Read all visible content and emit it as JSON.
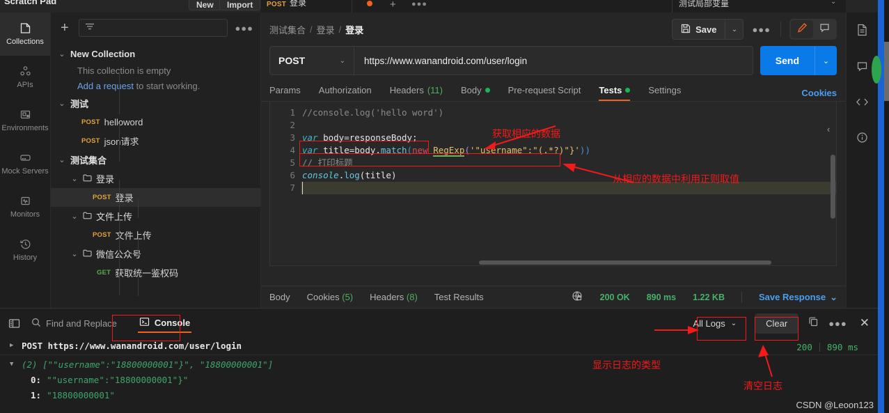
{
  "top": {
    "scratch_pad": "Scratch Pad",
    "new_label": "New",
    "import_label": "Import"
  },
  "rail": {
    "items": [
      {
        "label": "Collections",
        "icon": "collections-icon"
      },
      {
        "label": "APIs",
        "icon": "apis-icon"
      },
      {
        "label": "Environments",
        "icon": "environments-icon"
      },
      {
        "label": "Mock Servers",
        "icon": "mock-servers-icon"
      },
      {
        "label": "Monitors",
        "icon": "monitors-icon"
      },
      {
        "label": "History",
        "icon": "history-icon"
      }
    ]
  },
  "sidebar": {
    "filter_placeholder": "",
    "collections": [
      {
        "name": "New Collection",
        "empty_text": "This collection is empty",
        "empty_link": "Add a request",
        "empty_link_tail": " to start working."
      },
      {
        "name": "测试",
        "requests": [
          {
            "method": "POST",
            "name": "helloword"
          },
          {
            "method": "POST",
            "name": "json请求"
          }
        ]
      },
      {
        "name": "测试集合",
        "folders": [
          {
            "name": "登录",
            "requests": [
              {
                "method": "POST",
                "name": "登录",
                "selected": true
              }
            ]
          },
          {
            "name": "文件上传",
            "requests": [
              {
                "method": "POST",
                "name": "文件上传"
              }
            ]
          },
          {
            "name": "微信公众号",
            "requests": [
              {
                "method": "GET",
                "name": "获取统一鉴权码"
              }
            ]
          }
        ]
      }
    ]
  },
  "request_tab": {
    "method": "POST",
    "title": "登录",
    "environment": "测试局部变量"
  },
  "breadcrumb": {
    "items": [
      "测试集合",
      "登录",
      "登录"
    ],
    "separator": "/"
  },
  "actions": {
    "save_label": "Save",
    "save_icon": "floppy-disk-icon",
    "more_icon": "more-horizontal-icon",
    "edit_icon": "pencil-icon",
    "comment_icon": "comment-icon"
  },
  "url_bar": {
    "method": "POST",
    "url": "https://www.wanandroid.com/user/login",
    "send_label": "Send"
  },
  "param_tabs": {
    "items": [
      {
        "label": "Params"
      },
      {
        "label": "Authorization"
      },
      {
        "label": "Headers",
        "count": "(11)"
      },
      {
        "label": "Body",
        "dot": true
      },
      {
        "label": "Pre-request Script"
      },
      {
        "label": "Tests",
        "dot": true,
        "active": true
      },
      {
        "label": "Settings"
      }
    ],
    "cookies_label": "Cookies"
  },
  "editor": {
    "line_numbers": [
      "1",
      "2",
      "3",
      "4",
      "5",
      "6",
      "7"
    ],
    "lines": [
      "//console.log('hello word')",
      "",
      "var body=responseBody;",
      "var title=body.match(new RegExp('\"username\":\"(.*?)\"}'))",
      "// 打印标题",
      "console.log(title)",
      ""
    ],
    "tokens": {
      "l1_comment": "//console.log('hello word')",
      "l3_var": "var",
      "l3_rest": " body=responseBody;",
      "l4_var": "var",
      "l4_a": " title=",
      "l4_body": "body",
      "l4_dot": ".",
      "l4_match": "match",
      "l4_open": "(",
      "l4_new": "new",
      "l4_regexp": "RegExp",
      "l4_open2": "(",
      "l4_str": "'\"username\":\"(.*?)\"}'",
      "l4_close": "))",
      "l5_comment": "// 打印标题",
      "l6_console": "console",
      "l6_dot": ".",
      "l6_log": "log",
      "l6_args": "(title)"
    }
  },
  "response_bar": {
    "tabs": [
      "Body",
      "Cookies",
      "Headers",
      "Test Results"
    ],
    "cookies_count": "(5)",
    "headers_count": "(8)",
    "status": "200 OK",
    "time": "890 ms",
    "size": "1.22 KB",
    "save_response": "Save Response",
    "globe_icon": "globe-lock-icon"
  },
  "right_rail": {
    "items": [
      {
        "icon": "documentation-icon"
      },
      {
        "icon": "comment-icon"
      },
      {
        "icon": "code-snippet-icon"
      },
      {
        "icon": "info-icon"
      }
    ]
  },
  "console": {
    "layout_icon": "layout-panel-icon",
    "find_replace": "Find and Replace",
    "search_icon": "search-icon",
    "console_label": "Console",
    "console_icon": "terminal-icon",
    "all_logs": "All Logs",
    "clear_label": "Clear",
    "copy_icon": "copy-icon",
    "more_icon": "more-horizontal-icon",
    "close_icon": "close-icon",
    "status_code": "200",
    "status_time": "890 ms",
    "log_request": "POST https://www.wanandroid.com/user/login",
    "log_array_header": "(2) [\"\"username\":\"18800000001\"}\", \"18800000001\"]",
    "log_items": [
      {
        "index": "0:",
        "value": "\"\"username\":\"18800000001\"}\""
      },
      {
        "index": "1:",
        "value": "\"18800000001\""
      }
    ]
  },
  "annotations": [
    {
      "text": "获取相应的数据"
    },
    {
      "text": "从相应的数据中利用正则取值"
    },
    {
      "text": "显示日志的类型"
    },
    {
      "text": "清空日志"
    }
  ],
  "watermark": "CSDN @Leoon123",
  "colors": {
    "accent_orange": "#f06321",
    "send_blue": "#0a7ae8",
    "link_blue": "#4a9ff0",
    "status_green": "#46b26a",
    "annotation_red": "#f21a1a",
    "post_orange": "#e2a33c",
    "get_green": "#54b14c"
  }
}
